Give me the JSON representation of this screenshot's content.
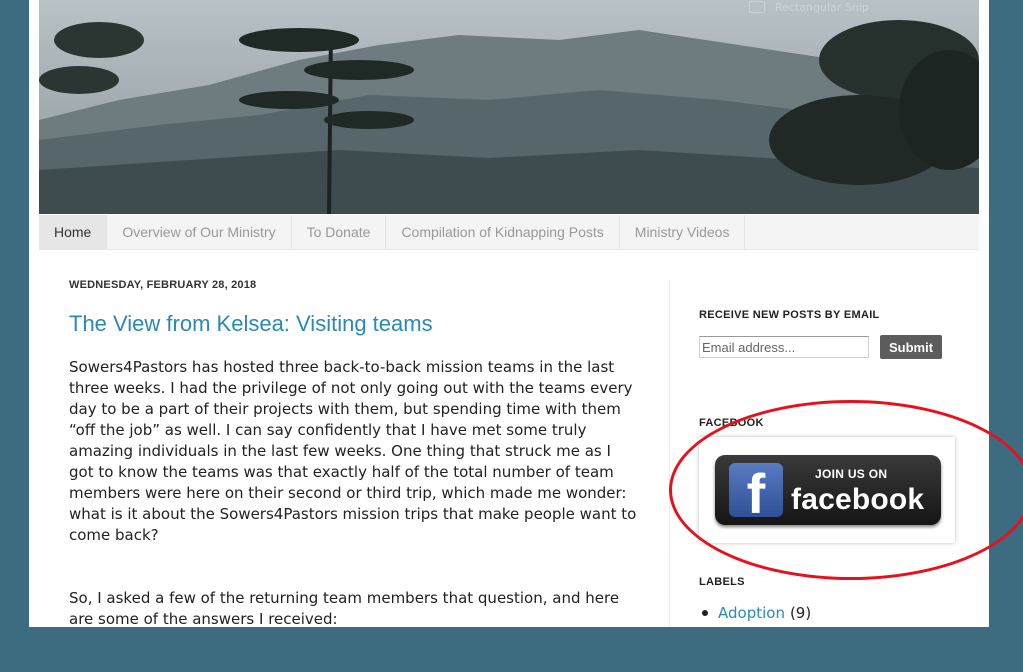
{
  "overlay": {
    "snip_label": "Rectangular Snip"
  },
  "header": {
    "image_icon": "mountain-forest-header-image"
  },
  "tabs": [
    {
      "label": "Home",
      "active": true
    },
    {
      "label": "Overview of Our Ministry"
    },
    {
      "label": "To Donate"
    },
    {
      "label": "Compilation of Kidnapping Posts"
    },
    {
      "label": "Ministry Videos"
    }
  ],
  "post": {
    "date": "WEDNESDAY, FEBRUARY 28, 2018",
    "title": "The View from Kelsea: Visiting teams",
    "paragraphs": [
      "Sowers4Pastors has hosted three back-to-back mission teams in the last three weeks. I had the privilege of not only going out with the teams every day to be a part of their projects with them, but spending time with them “off the job” as well. I can say confidently that I have met some truly amazing individuals in the last few weeks. One thing that struck me as I got to know the teams was that exactly half of the total number of team members were here on their second or third trip, which made me wonder: what is it about the Sowers4Pastors mission trips that make people want to come back?",
      "So, I asked a few of the returning team members that question, and here are some of the answers I received:"
    ]
  },
  "sidebar": {
    "email_widget": {
      "title": "RECEIVE NEW POSTS BY EMAIL",
      "placeholder": "Email address...",
      "button": "Submit"
    },
    "facebook_widget": {
      "title": "FACEBOOK",
      "join_text": "JOIN US ON",
      "brand": "facebook",
      "icon": "facebook-f-icon"
    },
    "labels_widget": {
      "title": "LABELS",
      "items": [
        {
          "name": "Adoption",
          "count": "(9)"
        }
      ]
    }
  },
  "colors": {
    "background": "#3d6b80",
    "link": "#2a8ab5",
    "annotation": "#e8101c",
    "button": "#5c5c5c"
  }
}
